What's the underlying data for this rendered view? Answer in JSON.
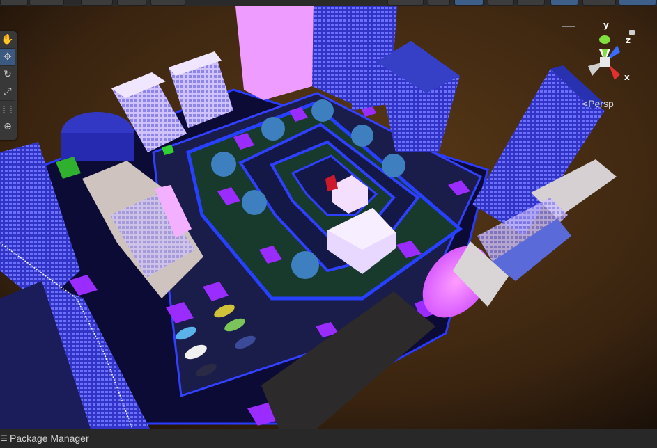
{
  "scene_view": {
    "camera_mode": "Persp",
    "gizmo": {
      "x": "x",
      "y": "y",
      "z": "z"
    },
    "tools": [
      {
        "name": "hand-tool",
        "glyph": "✋"
      },
      {
        "name": "move-tool",
        "glyph": "✥"
      },
      {
        "name": "rotate-tool",
        "glyph": "↻"
      },
      {
        "name": "scale-tool",
        "glyph": "⤢"
      },
      {
        "name": "rect-tool",
        "glyph": "⬚"
      },
      {
        "name": "transform-tool",
        "glyph": "⊕"
      }
    ]
  },
  "status_bar": {
    "label": "Package Manager"
  },
  "colors": {
    "ground": "#0c0b35",
    "road": "#1a1c4a",
    "edge": "#2a3bff",
    "grass": "#173a2c",
    "neon": "#9b2cff",
    "tower": "#3b3fd6",
    "white_building": "#e8d7ff"
  }
}
